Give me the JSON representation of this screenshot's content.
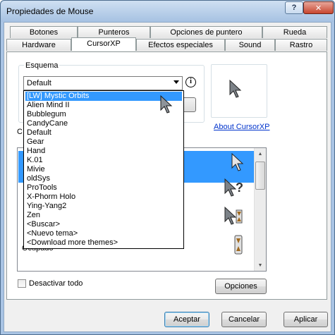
{
  "window": {
    "title": "Propiedades de Mouse",
    "help_label": "?",
    "close_label": "✕"
  },
  "tabs": {
    "row1": [
      {
        "label": "Botones"
      },
      {
        "label": "Punteros"
      },
      {
        "label": "Opciones de puntero"
      },
      {
        "label": "Rueda"
      }
    ],
    "row2": [
      {
        "label": "Hardware"
      },
      {
        "label": "CursorXP"
      },
      {
        "label": "Efectos especiales"
      },
      {
        "label": "Sound"
      },
      {
        "label": "Rastro"
      }
    ],
    "active": "CursorXP"
  },
  "scheme": {
    "group_label": "Esquema",
    "selected_value": "Default",
    "info_icon": "info-icon",
    "options": [
      "[LW] Mystic Orbits",
      "Alien Mind II",
      "Bubblegum",
      "CandyCane",
      "Default",
      "Gear",
      "Hand",
      "K.01",
      "Mivie",
      "oldSys",
      "ProTools",
      "X-Phorm Holo",
      "Ying-Yang2",
      "Zen",
      "<Buscar>",
      "<Nuevo tema>",
      "<Download more themes>"
    ],
    "highlighted_index": 0
  },
  "about_link": "About CursorXP",
  "partial_label": "C",
  "cursor_list": {
    "visible_row_label": "Ocupado"
  },
  "disable_all_label": "Desactivar todo",
  "options_button": "Opciones",
  "footer": {
    "accept": "Aceptar",
    "cancel": "Cancelar",
    "apply": "Aplicar"
  },
  "colors": {
    "selection": "#3399ff",
    "link": "#0033cc"
  }
}
